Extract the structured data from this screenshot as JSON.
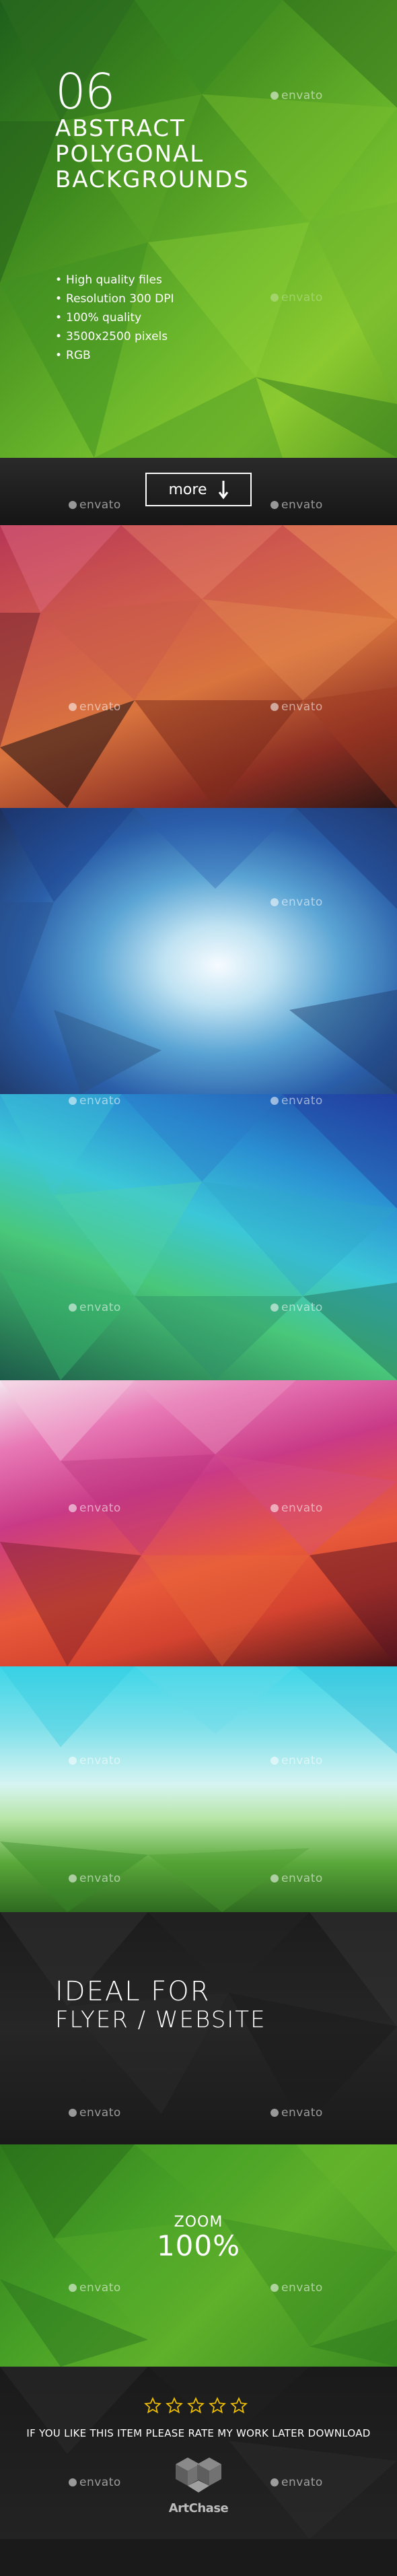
{
  "hero": {
    "number": "06",
    "line1": "ABSTRACT",
    "line2": "POLYGONAL",
    "line3": "BACKGROUNDS",
    "features": [
      "High quality files",
      "Resolution 300 DPI",
      "100% quality",
      "3500x2500 pixels",
      "RGB"
    ]
  },
  "watermark": "envato",
  "more_button": {
    "label": "more",
    "icon": "arrow-down-icon"
  },
  "ideal": {
    "line1": "IDEAL FOR",
    "line2": "FLYER / WEBSITE"
  },
  "zoom": {
    "label": "ZOOM",
    "value": "100%"
  },
  "footer": {
    "rating_stars": 5,
    "rate_text": "IF YOU LIKE THIS ITEM PLEASE RATE MY WORK LATER DOWNLOAD",
    "brand": "ArtChase"
  },
  "colors": {
    "green": "#4a9a25",
    "star": "#f2c200",
    "dark": "#1a1a1a"
  }
}
